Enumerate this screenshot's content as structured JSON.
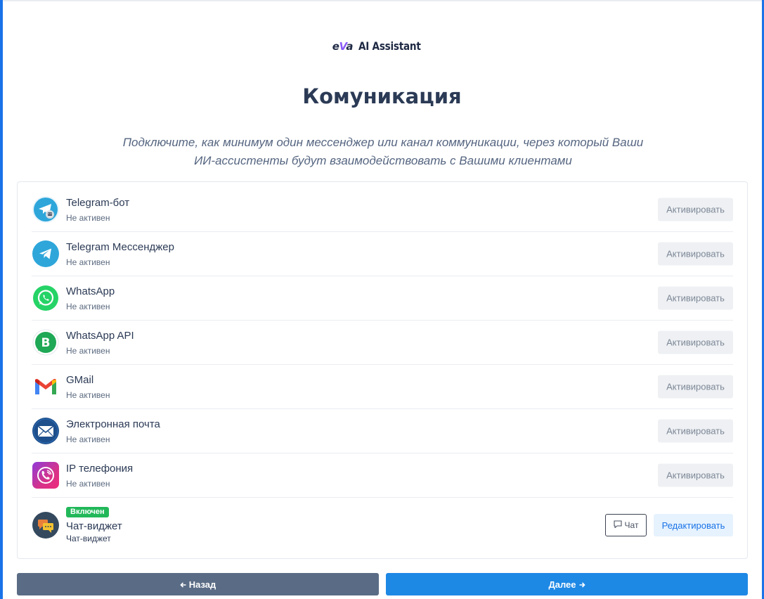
{
  "logo": {
    "mark_e": "e",
    "mark_v": "V",
    "mark_a": "a",
    "text": "AI Assistant"
  },
  "page": {
    "title": "Комуникация",
    "subtitle": "Подключите, как минимум один мессенджер или канал коммуникации, через который Ваши ИИ-ассистенты будут взаимодействовать с Вашими клиентами"
  },
  "channels": [
    {
      "name": "Telegram-бот",
      "status": "Не активен",
      "action": "Активировать",
      "icon": "telegram-bot-icon"
    },
    {
      "name": "Telegram Мессенджер",
      "status": "Не активен",
      "action": "Активировать",
      "icon": "telegram-icon"
    },
    {
      "name": "WhatsApp",
      "status": "Не активен",
      "action": "Активировать",
      "icon": "whatsapp-icon"
    },
    {
      "name": "WhatsApp API",
      "status": "Не активен",
      "action": "Активировать",
      "icon": "whatsapp-business-icon"
    },
    {
      "name": "GMail",
      "status": "Не активен",
      "action": "Активировать",
      "icon": "gmail-icon"
    },
    {
      "name": "Электронная почта",
      "status": "Не активен",
      "action": "Активировать",
      "icon": "email-icon"
    },
    {
      "name": "IP телефония",
      "status": "Не активен",
      "action": "Активировать",
      "icon": "viber-phone-icon"
    }
  ],
  "widget": {
    "badge": "Включен",
    "name": "Чат-виджет",
    "subname": "Чат-виджет",
    "chat_label": "Чат",
    "edit_label": "Редактировать",
    "icon": "chat-widget-icon"
  },
  "nav": {
    "back_label": "Назад",
    "next_label": "Далее"
  },
  "colors": {
    "primary": "#1e88e5",
    "secondary": "#5a6c85",
    "success": "#22b85a"
  }
}
